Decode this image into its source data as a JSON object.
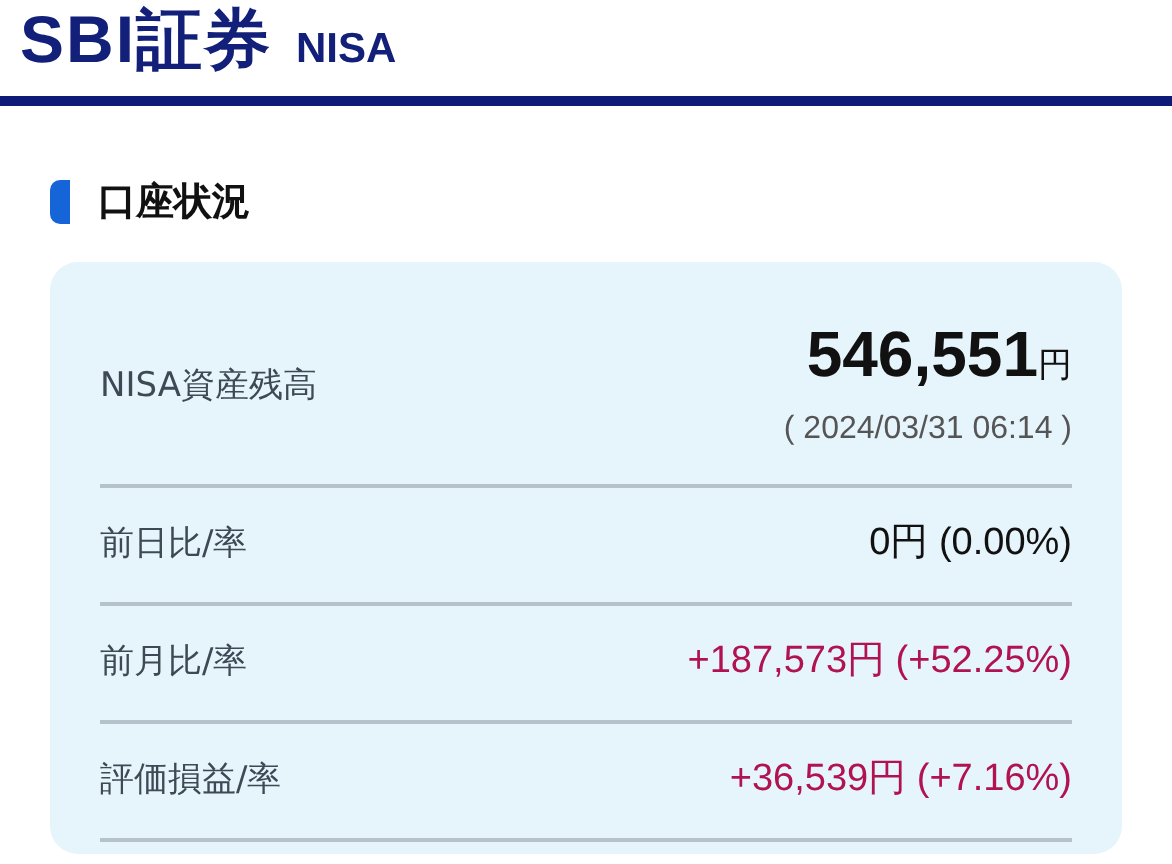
{
  "header": {
    "logo": "SBI証券",
    "sublabel": "NISA"
  },
  "section": {
    "title": "口座状況"
  },
  "balance": {
    "label": "NISA資産残高",
    "amount": "546,551",
    "unit": "円",
    "timestamp": "( 2024/03/31 06:14 )"
  },
  "rows": [
    {
      "label": "前日比/率",
      "value": "0円 (0.00%)",
      "color": "#111111"
    },
    {
      "label": "前月比/率",
      "value": "+187,573円 (+52.25%)",
      "color": "#b0134f"
    },
    {
      "label": "評価損益/率",
      "value": "+36,539円 (+7.16%)",
      "color": "#b0134f"
    }
  ]
}
